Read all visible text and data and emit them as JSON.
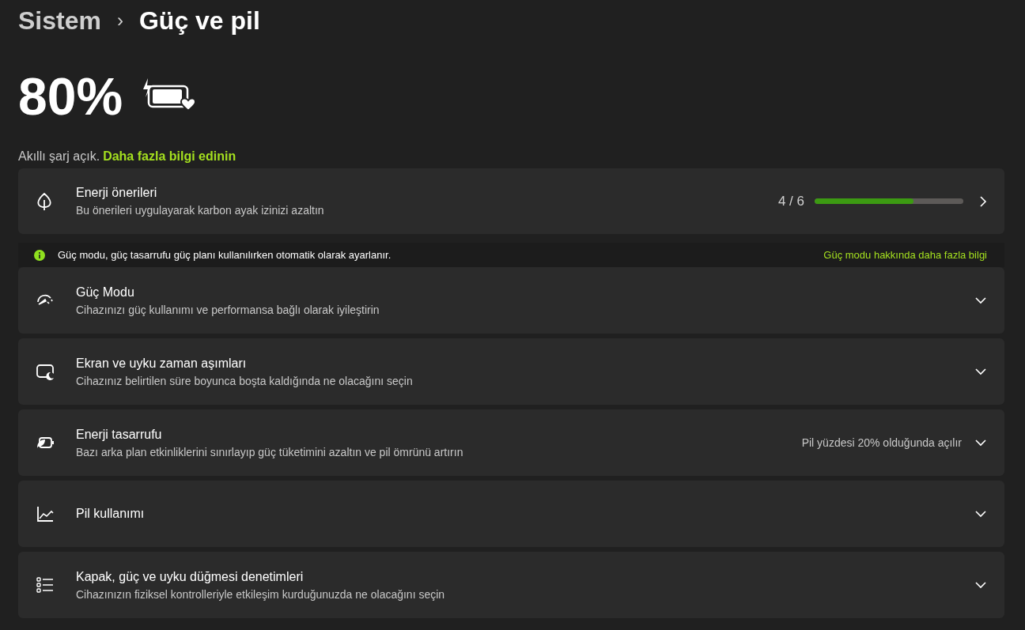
{
  "breadcrumb": {
    "parent": "Sistem",
    "separator": "›",
    "current": "Güç ve pil"
  },
  "battery": {
    "percent": "80%"
  },
  "smart_charge": {
    "text": "Akıllı şarj açık.",
    "link": "Daha fazla bilgi edinin"
  },
  "recommendations": {
    "title": "Enerji önerileri",
    "subtitle": "Bu önerileri uygulayarak karbon ayak izinizi azaltın",
    "count": "4 / 6",
    "level": 0.667
  },
  "info_bar": {
    "text": "Güç modu, güç tasarrufu güç planı kullanılırken otomatik olarak ayarlanır.",
    "link": "Güç modu hakkında daha fazla bilgi"
  },
  "settings": [
    {
      "title": "Güç Modu",
      "subtitle": "Cihazınızı güç kullanımı ve performansa bağlı olarak iyileştirin",
      "expanded": false
    },
    {
      "title": "Ekran ve uyku zaman aşımları",
      "subtitle": "Cihazınız belirtilen süre boyunca boşta kaldığında ne olacağını seçin",
      "expanded": false
    },
    {
      "title": "Enerji tasarrufu",
      "subtitle": "Bazı arka plan etkinliklerini sınırlayıp güç tüketimini azaltın ve pil ömrünü artırın",
      "status": "Pil yüzdesi 20% olduğunda açılır",
      "expanded": false
    },
    {
      "title": "Pil kullanımı",
      "expanded": false
    },
    {
      "title": "Kapak, güç ve uyku düğmesi denetimleri",
      "subtitle": "Cihazınızın fiziksel kontrolleriyle etkileşim kurduğunuzda ne olacağını seçin",
      "expanded": false
    }
  ]
}
